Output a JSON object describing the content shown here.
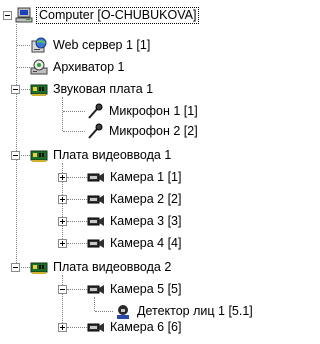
{
  "tree": {
    "root": {
      "label": "Computer [O-CHUBUKOVA]"
    },
    "web_server": {
      "label": "Web сервер 1 [1]"
    },
    "archiver": {
      "label": "Архиватор 1"
    },
    "sound_card": {
      "label": "Звуковая плата 1",
      "mic1": {
        "label": "Микрофон 1 [1]"
      },
      "mic2": {
        "label": "Микрофон 2 [2]"
      }
    },
    "video_board1": {
      "label": "Плата видеоввода 1",
      "cameras": [
        {
          "label": "Камера 1 [1]"
        },
        {
          "label": "Камера 2 [2]"
        },
        {
          "label": "Камера 3 [3]"
        },
        {
          "label": "Камера 4 [4]"
        }
      ]
    },
    "video_board2": {
      "label": "Плата видеоввода 2",
      "camera5": {
        "label": "Камера 5 [5]",
        "face_detector": {
          "label": "Детектор лиц 1 [5.1]"
        }
      },
      "camera6": {
        "label": "Камера 6 [6]"
      }
    }
  }
}
